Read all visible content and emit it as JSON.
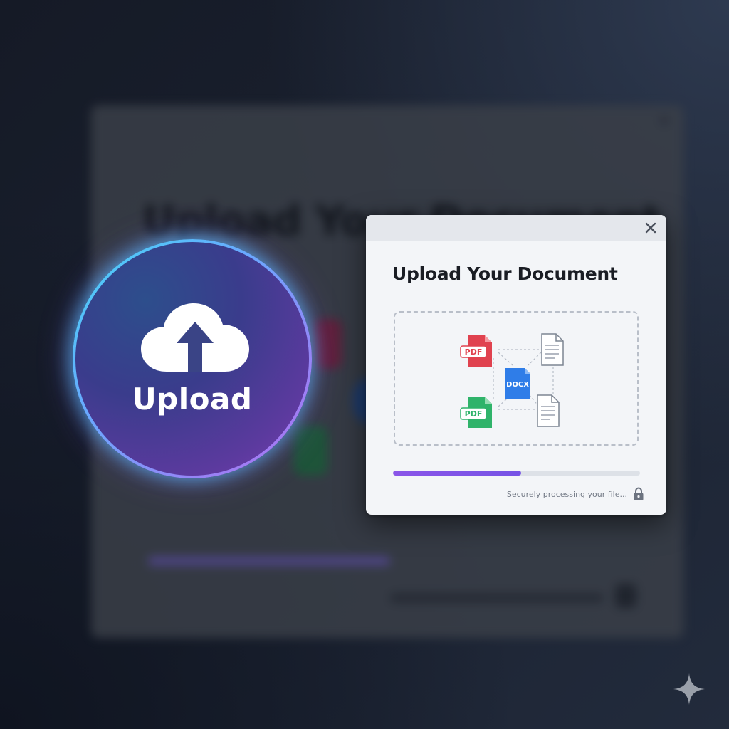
{
  "upload_button": {
    "label": "Upload",
    "icon": "cloud-upload-icon"
  },
  "dialog": {
    "title": "Upload Your Document",
    "close_icon": "close-icon",
    "drop_zone": {
      "file_types": {
        "pdf_red": "PDF",
        "pdf_green": "PDF",
        "docx": "DOCX"
      },
      "icons": [
        "pdf-file-icon",
        "docx-file-icon",
        "pdf-file-icon",
        "text-document-icon",
        "text-document-icon"
      ]
    },
    "progress": 0.52,
    "status_text": "Securely processing your file...",
    "status_icon": "lock-icon"
  },
  "colors": {
    "accent": "#8a55e8",
    "pdf_red": "#e0424f",
    "pdf_green": "#2fb36a",
    "docx_blue": "#2f7de8",
    "ring_cyan": "#44d6f5",
    "ring_purple": "#b46cf0"
  },
  "corner_icon": "sparkle-icon"
}
